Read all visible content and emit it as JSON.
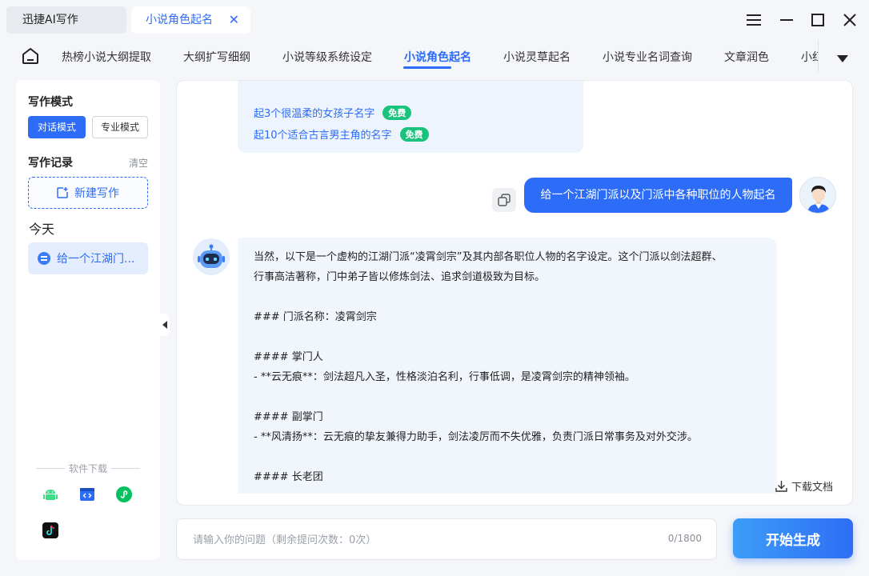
{
  "tabs": [
    {
      "label": "迅捷AI写作"
    },
    {
      "label": "小说角色起名"
    }
  ],
  "nav": {
    "items": [
      "热榜小说大纲提取",
      "大纲扩写细纲",
      "小说等级系统设定",
      "小说角色起名",
      "小说灵草起名",
      "小说专业名词查询",
      "文章润色",
      "小红书"
    ],
    "active_index": 3
  },
  "sidebar": {
    "mode_title": "写作模式",
    "mode_chat": "对话模式",
    "mode_pro": "专业模式",
    "record_title": "写作记录",
    "clear": "清空",
    "new_writing": "新建写作",
    "today": "今天",
    "history_item": "给一个江湖门...",
    "download_title": "软件下载",
    "download_icons": [
      "android-icon",
      "windows-icon",
      "mini-program-icon",
      "tiktok-icon"
    ]
  },
  "chat": {
    "suggestions": [
      {
        "text": "起3个很温柔的女孩子名字",
        "badge": "免费"
      },
      {
        "text": "起10个适合古言男主角的名字",
        "badge": "免费"
      }
    ],
    "user_message": "给一个江湖门派以及门派中各种职位的人物起名",
    "bot_lines": [
      "当然，以下是一个虚构的江湖门派“凌霄剑宗”及其内部各职位人物的名字设定。这个门派以剑法超群、",
      "行事高洁著称，门中弟子皆以修炼剑法、追求剑道极致为目标。",
      "",
      "### 门派名称：凌霄剑宗",
      "",
      "#### 掌门人",
      "- **云无痕**：剑法超凡入圣，性格淡泊名利，行事低调，是凌霄剑宗的精神领袖。",
      "",
      "#### 副掌门",
      "- **风清扬**：云无痕的挚友兼得力助手，剑法凌厉而不失优雅，负责门派日常事务及对外交涉。",
      "",
      "#### 长老团"
    ],
    "download_doc": "下载文档"
  },
  "input": {
    "placeholder": "请输入你的问题（剩余提问次数：0次）",
    "value": "",
    "counter": "0/1800"
  },
  "generate_button": "开始生成",
  "colors": {
    "primary": "#2d6cf6",
    "free_badge": "#19c37d",
    "background": "#f4f6f9"
  }
}
